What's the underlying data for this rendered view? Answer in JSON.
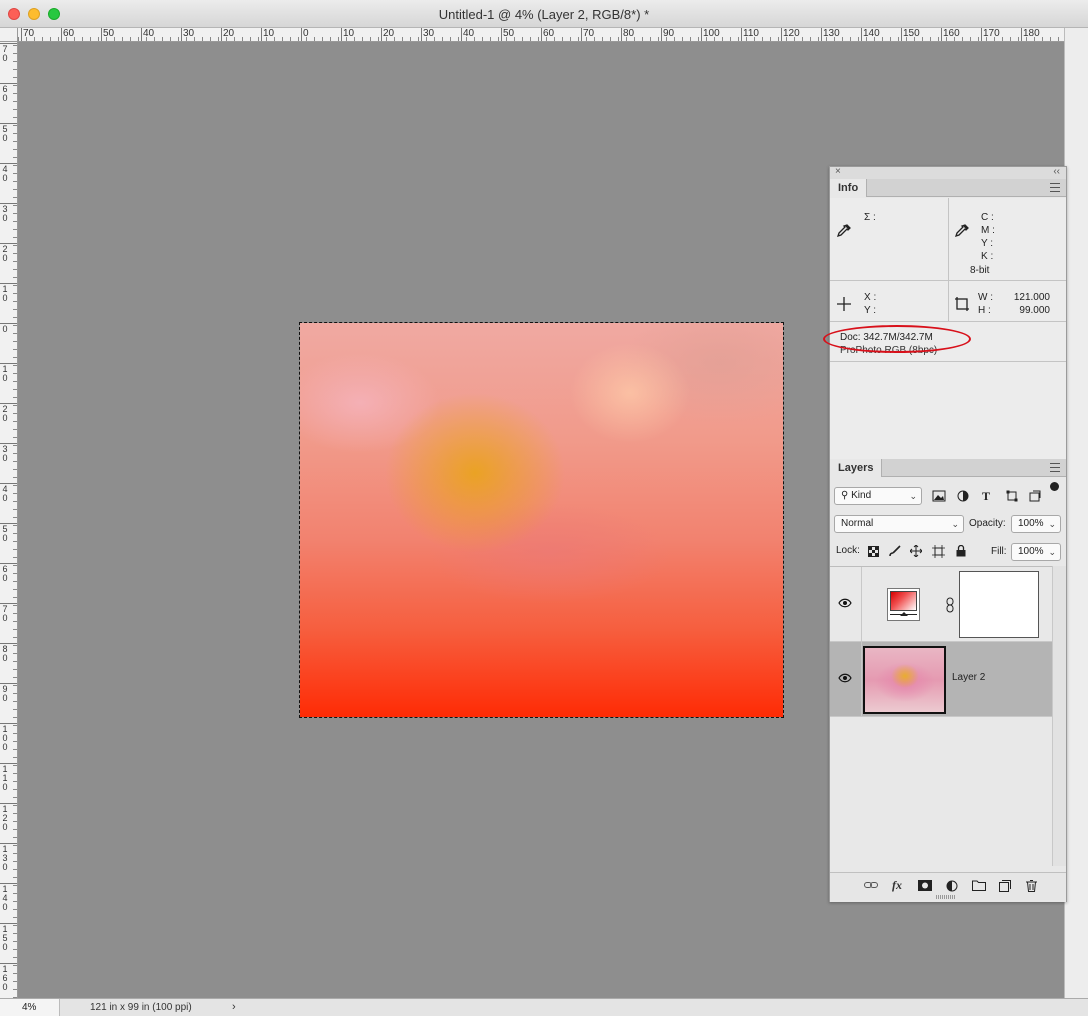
{
  "window": {
    "title": "Untitled-1 @ 4% (Layer 2, RGB/8*) *"
  },
  "ruler": {
    "top_labels": [
      "70",
      "60",
      "50",
      "40",
      "30",
      "20",
      "10",
      "0",
      "10",
      "20",
      "30",
      "40",
      "50",
      "60",
      "70",
      "80",
      "90",
      "100",
      "110",
      "120",
      "130",
      "140",
      "150",
      "160",
      "170",
      "180"
    ],
    "left_labels": [
      "70",
      "60",
      "50",
      "40",
      "30",
      "20",
      "10",
      "0",
      "10",
      "20",
      "30",
      "40",
      "50",
      "60",
      "70",
      "80",
      "90",
      "100",
      "110",
      "120",
      "130",
      "140",
      "150",
      "160"
    ]
  },
  "status": {
    "zoom": "4%",
    "doc_size": "121 in x 99 in (100 ppi)",
    "arrow": "›"
  },
  "info_panel": {
    "tab": "Info",
    "sigma_label": "Σ :",
    "cmyk_labels": [
      "C :",
      "M :",
      "Y :",
      "K :"
    ],
    "bit_depth": "8-bit",
    "xy_labels": [
      "X :",
      "Y :"
    ],
    "wh_labels": [
      "W :",
      "H :"
    ],
    "width_value": "121.000",
    "height_value": "99.000",
    "doc_line": "Doc: 342.7M/342.7M",
    "profile_line": "ProPhoto RGB (8bpc)",
    "annotation_color": "#d8101a"
  },
  "layers_panel": {
    "tab": "Layers",
    "filter_kind": "Kind",
    "blend_mode": "Normal",
    "opacity_label": "Opacity:",
    "opacity_value": "100%",
    "lock_label": "Lock:",
    "fill_label": "Fill:",
    "fill_value": "100%",
    "layers": [
      {
        "name": "",
        "type": "gradient-map-adjustment",
        "visible": true,
        "selected": false
      },
      {
        "name": "Layer 2",
        "type": "pixel",
        "visible": true,
        "selected": true
      }
    ]
  },
  "icons": {
    "eyedropper": "eyedropper-icon",
    "crosshair": "crosshair-icon",
    "selection_rect": "selection-rect-icon",
    "eye": "eye-icon",
    "chain": "chain-link-icon"
  }
}
